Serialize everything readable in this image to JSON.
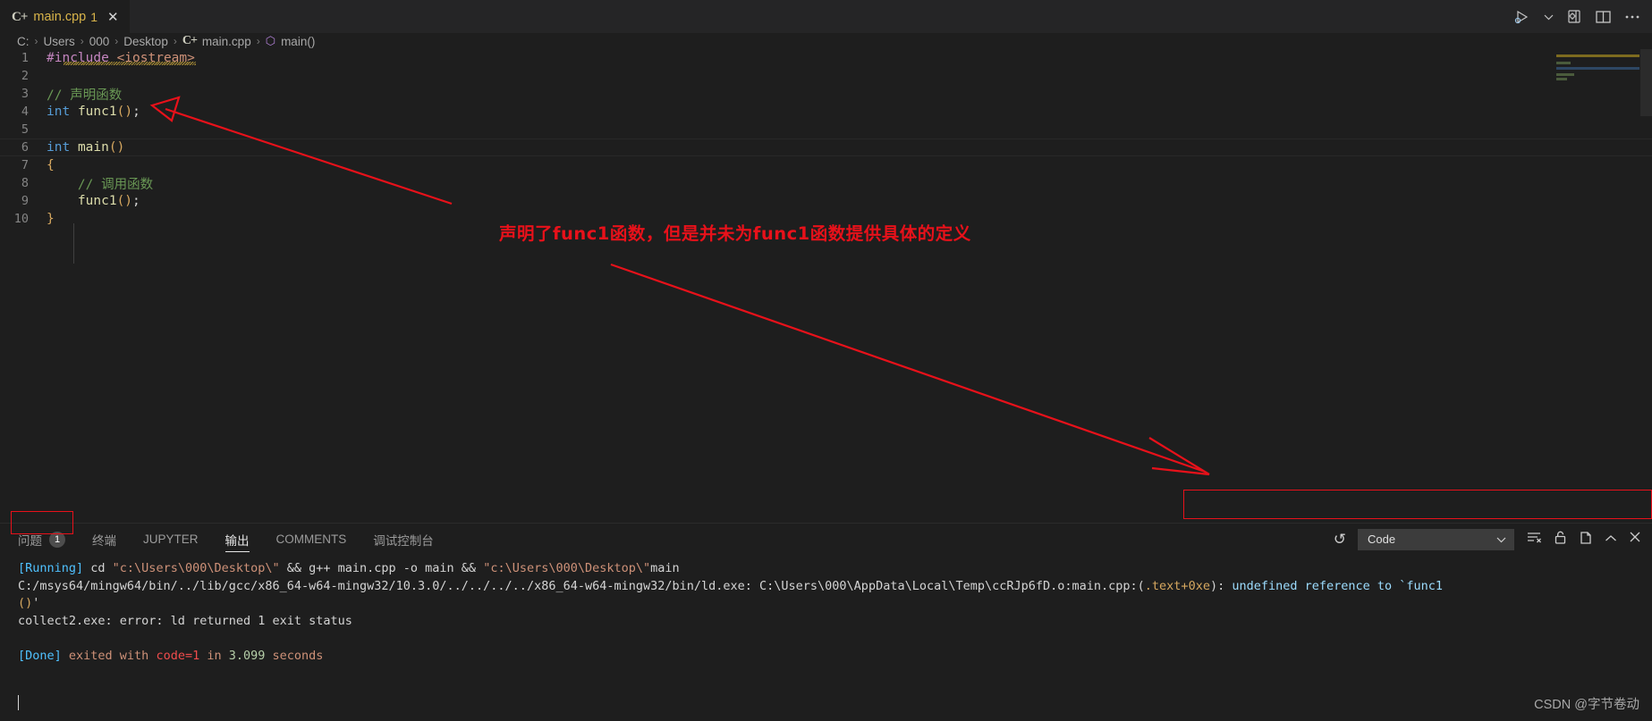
{
  "window": {
    "tab": {
      "icon": "cpp-file-icon",
      "glyph": "C+",
      "label": "main.cpp",
      "badge": "1",
      "close": "✕"
    },
    "actions": [
      {
        "name": "run-and-debug-icon",
        "label": "▷"
      },
      {
        "name": "chevron-down-icon",
        "label": "ˇ"
      },
      {
        "name": "toggle-settings-panel-icon",
        "label": "⚙"
      },
      {
        "name": "split-editor-icon",
        "label": "▥"
      },
      {
        "name": "more-actions-icon",
        "label": "⋯"
      }
    ]
  },
  "breadcrumb": {
    "separator": "›",
    "items": [
      {
        "label": "C:",
        "icon": ""
      },
      {
        "label": "Users",
        "icon": ""
      },
      {
        "label": "000",
        "icon": ""
      },
      {
        "label": "Desktop",
        "icon": ""
      },
      {
        "label": "main.cpp",
        "icon": "cpp-file-icon",
        "glyph": "C+"
      },
      {
        "label": "main()",
        "icon": "symbol-function-icon",
        "glyph": "⬡"
      }
    ]
  },
  "editor": {
    "lines": [
      {
        "num": "1",
        "segments": [
          {
            "text": "#include",
            "cls": "t-pre"
          },
          {
            "text": " ",
            "cls": "t-pun"
          },
          {
            "text": "<iostream>",
            "cls": "t-str"
          }
        ]
      },
      {
        "num": "2",
        "segments": []
      },
      {
        "num": "3",
        "segments": [
          {
            "text": "// 声明函数",
            "cls": "t-cmt"
          }
        ]
      },
      {
        "num": "4",
        "segments": [
          {
            "text": "int",
            "cls": "t-kw"
          },
          {
            "text": " ",
            "cls": "t-pun"
          },
          {
            "text": "func1",
            "cls": "t-fn"
          },
          {
            "text": "()",
            "cls": "t-par"
          },
          {
            "text": ";",
            "cls": "t-pun"
          }
        ]
      },
      {
        "num": "5",
        "segments": []
      },
      {
        "num": "6",
        "segments": [
          {
            "text": "int",
            "cls": "t-kw"
          },
          {
            "text": " ",
            "cls": "t-pun"
          },
          {
            "text": "main",
            "cls": "t-fn"
          },
          {
            "text": "()",
            "cls": "t-par"
          }
        ]
      },
      {
        "num": "7",
        "segments": [
          {
            "text": "{",
            "cls": "t-br"
          }
        ]
      },
      {
        "num": "8",
        "segments": [
          {
            "text": "    // 调用函数",
            "cls": "t-cmt"
          }
        ]
      },
      {
        "num": "9",
        "segments": [
          {
            "text": "    ",
            "cls": "t-pun"
          },
          {
            "text": "func1",
            "cls": "t-fn"
          },
          {
            "text": "()",
            "cls": "t-par"
          },
          {
            "text": ";",
            "cls": "t-pun"
          }
        ]
      },
      {
        "num": "10",
        "segments": [
          {
            "text": "}",
            "cls": "t-br"
          }
        ]
      }
    ]
  },
  "annotations": {
    "note": "声明了func1函数，但是并未为func1函数提供具体的定义",
    "color": "#e8111a"
  },
  "panel": {
    "tabs": [
      {
        "name": "tab-problems",
        "label": "问题",
        "badge": "1",
        "active": false
      },
      {
        "name": "tab-terminal",
        "label": "终端",
        "badge": "",
        "active": false
      },
      {
        "name": "tab-jupyter",
        "label": "JUPYTER",
        "badge": "",
        "active": false
      },
      {
        "name": "tab-output",
        "label": "输出",
        "badge": "",
        "active": true
      },
      {
        "name": "tab-comments",
        "label": "COMMENTS",
        "badge": "",
        "active": false
      },
      {
        "name": "tab-debug-console",
        "label": "调试控制台",
        "badge": "",
        "active": false
      }
    ],
    "refresh_icon": "↺",
    "output_channel": {
      "value": "Code",
      "chevron": "ˇ"
    },
    "actions": [
      {
        "name": "clear-output-icon",
        "label": "clear"
      },
      {
        "name": "lock-icon",
        "label": "lock"
      },
      {
        "name": "open-in-editor-icon",
        "label": "open"
      },
      {
        "name": "collapse-panel-icon",
        "label": "˄"
      },
      {
        "name": "close-panel-icon",
        "label": "✕"
      }
    ],
    "output": [
      {
        "segments": [
          {
            "text": "[Running] ",
            "cls": "o-blue"
          },
          {
            "text": "cd ",
            "cls": "o-white"
          },
          {
            "text": "\"c:\\Users\\000\\Desktop\\\"",
            "cls": "o-org"
          },
          {
            "text": " && g++ main.cpp -o main && ",
            "cls": "o-white"
          },
          {
            "text": "\"c:\\Users\\000\\Desktop\\\"",
            "cls": "o-org"
          },
          {
            "text": "main",
            "cls": "o-white"
          }
        ]
      },
      {
        "segments": [
          {
            "text": "C:/msys64/mingw64/bin/../lib/gcc/x86_64-w64-mingw32/10.3.0/../../../../x86_64-w64-mingw32/bin/ld.exe: C:\\Users\\000\\AppData\\Local\\Temp\\ccRJp6fD.o:main.cpp:(",
            "cls": "o-white"
          },
          {
            "text": ".text+0xe",
            "cls": "o-gold"
          },
          {
            "text": "): ",
            "cls": "o-white"
          },
          {
            "text": "undefined reference to `func1",
            "cls": "o-cyan"
          }
        ]
      },
      {
        "segments": [
          {
            "text": "()",
            "cls": "o-gold"
          },
          {
            "text": "'",
            "cls": "o-white"
          }
        ]
      },
      {
        "segments": [
          {
            "text": "collect2.exe: error: ld returned 1 exit status",
            "cls": "o-white"
          }
        ]
      },
      {
        "segments": []
      },
      {
        "segments": [
          {
            "text": "[Done] ",
            "cls": "o-blue"
          },
          {
            "text": "exited with ",
            "cls": "o-org"
          },
          {
            "text": "code=1",
            "cls": "o-red"
          },
          {
            "text": " in ",
            "cls": "o-org"
          },
          {
            "text": "3.099",
            "cls": "o-green"
          },
          {
            "text": " seconds",
            "cls": "o-org"
          }
        ]
      }
    ]
  },
  "watermark": "CSDN @字节卷动"
}
